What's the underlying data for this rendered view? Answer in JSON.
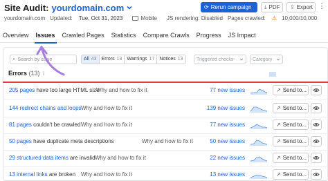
{
  "header": {
    "title": "Site Audit:",
    "domain": "yourdomain.com",
    "sub_domain": "yourdomain.com",
    "updated_label": "Updated:",
    "updated_value": "Tue, Oct 31, 2023",
    "device": "Mobile",
    "js_rendering": "JS rendering: Disabled",
    "pages_crawled_label": "Pages crawled:",
    "pages_crawled_value": "10,000/10,000",
    "run_button": "Rerun campaign",
    "pdf_button": "PDF",
    "export_button": "Export",
    "more": "⋮"
  },
  "tabs": [
    {
      "label": "Overview"
    },
    {
      "label": "Issues",
      "active": true
    },
    {
      "label": "Crawled Pages"
    },
    {
      "label": "Statistics"
    },
    {
      "label": "Compare Crawls"
    },
    {
      "label": "Progress"
    },
    {
      "label": "JS Impact"
    }
  ],
  "filters": {
    "search_placeholder": "Search by issue",
    "all_label": "All",
    "all_count": "43",
    "errors_label": "Errors",
    "errors_count": "13",
    "warnings_label": "Warnings",
    "warnings_count": "17",
    "notices_label": "Notices",
    "notices_count": "13",
    "checks_placeholder": "Triggered checks",
    "category_placeholder": "Category"
  },
  "errors_section": {
    "title": "Errors",
    "count": "(13)",
    "info": "i"
  },
  "rows": [
    {
      "count": "205 pages",
      "text": " have too large HTML size",
      "why": "Why and how to fix it",
      "new": "77 new issues",
      "send": "Send to..."
    },
    {
      "count": "144 redirect chains and loops",
      "text": "",
      "why": "Why and how to fix it",
      "new": "139 new issues",
      "send": "Send to..."
    },
    {
      "count": "81 pages",
      "text": " couldn't be crawled",
      "why": "Why and how to fix it",
      "new": "77 new issues",
      "send": "Send to..."
    },
    {
      "count": "50 pages",
      "text": " have duplicate meta descriptions",
      "why": "Why and how to fix it",
      "new": "50 new issues",
      "send": "Send to..."
    },
    {
      "count": "29 structured data items",
      "text": " are invalid",
      "why": "Why and how to fix it",
      "new": "22 new issues",
      "send": "Send to..."
    },
    {
      "count": "13 internal links",
      "text": " are broken",
      "why": "Why and how to fix it",
      "new": "13 new issues",
      "send": "Send to..."
    }
  ],
  "colors": {
    "accent": "#1a62d6",
    "error_line": "#e03a3a",
    "annotation_arrow": "#a77be0"
  }
}
